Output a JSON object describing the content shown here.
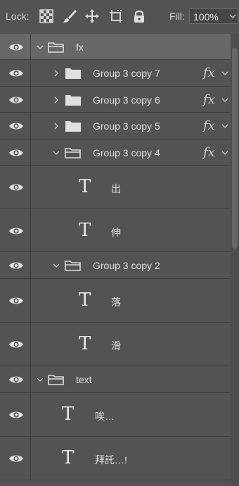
{
  "lock": {
    "label": "Lock:",
    "icons": [
      "lock-transparent-pixels-icon",
      "lock-image-pixels-icon",
      "lock-position-icon",
      "lock-artboard-icon",
      "lock-all-icon"
    ]
  },
  "fill": {
    "label": "Fill:",
    "value": "100%"
  },
  "layers": [
    {
      "name": "fx",
      "kind": "group",
      "expanded": true,
      "indent": 0,
      "selected": true,
      "fx": false
    },
    {
      "name": "Group 3 copy 7",
      "kind": "group",
      "expanded": false,
      "indent": 1,
      "fx": true,
      "fx_label": "fx"
    },
    {
      "name": "Group 3 copy 6",
      "kind": "group",
      "expanded": false,
      "indent": 1,
      "fx": true,
      "fx_label": "fx"
    },
    {
      "name": "Group 3 copy 5",
      "kind": "group",
      "expanded": false,
      "indent": 1,
      "fx": true,
      "fx_label": "fx"
    },
    {
      "name": "Group 3 copy 4",
      "kind": "group",
      "expanded": true,
      "indent": 1,
      "fx": true,
      "fx_label": "fx"
    },
    {
      "name": "出",
      "kind": "text",
      "indent": 2,
      "glyph": "T"
    },
    {
      "name": "伸",
      "kind": "text",
      "indent": 2,
      "glyph": "T"
    },
    {
      "name": "Group 3 copy 2",
      "kind": "group",
      "expanded": true,
      "indent": 1,
      "fx": false
    },
    {
      "name": "落",
      "kind": "text",
      "indent": 2,
      "glyph": "T"
    },
    {
      "name": "滑",
      "kind": "text",
      "indent": 2,
      "glyph": "T"
    },
    {
      "name": "text",
      "kind": "group",
      "expanded": true,
      "indent": 0,
      "fx": false
    },
    {
      "name": "唉…",
      "kind": "text",
      "indent": 1,
      "glyph": "T"
    },
    {
      "name": "拜託…!",
      "kind": "text",
      "indent": 1,
      "glyph": "T"
    }
  ]
}
